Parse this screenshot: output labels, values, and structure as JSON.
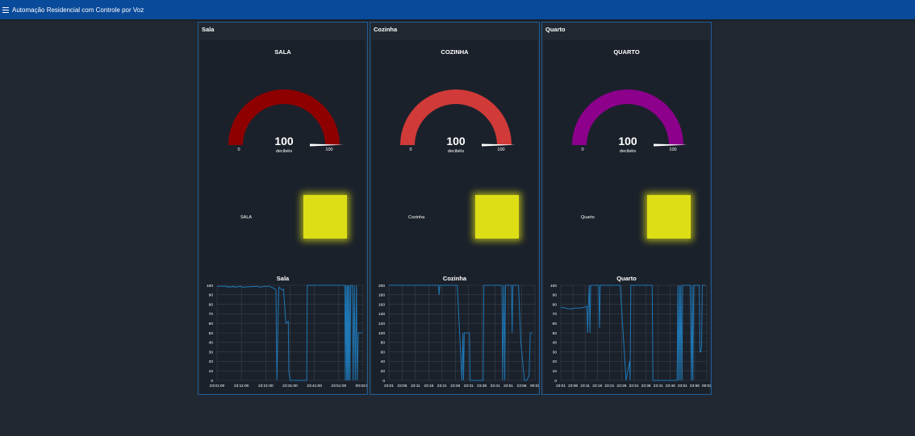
{
  "app": {
    "title": "Automação Residencial com Controle por Voz"
  },
  "groups": [
    {
      "name": "Sala",
      "gauge": {
        "title": "SALA",
        "value": "100",
        "units": "decibéis",
        "min": "0",
        "max": "100",
        "color": "#8e0000"
      },
      "led": {
        "label": "SALA",
        "color": "#dede16"
      }
    },
    {
      "name": "Cozinha",
      "gauge": {
        "title": "COZINHA",
        "value": "100",
        "units": "decibéis",
        "min": "0",
        "max": "100",
        "color": "#d03a38"
      },
      "led": {
        "label": "Cozinha",
        "color": "#dede16"
      }
    },
    {
      "name": "Quarto",
      "gauge": {
        "title": "QUARTO",
        "value": "100",
        "units": "decibéis",
        "min": "0",
        "max": "100",
        "color": "#8c008c"
      },
      "led": {
        "label": "Quarto",
        "color": "#dede16"
      }
    }
  ],
  "chart_data": [
    {
      "type": "line",
      "title": "Sala",
      "ylim": [
        0,
        100
      ],
      "yticks": [
        0,
        10,
        20,
        30,
        40,
        50,
        60,
        70,
        80,
        90,
        100
      ],
      "xticks": [
        "23:01:00",
        "23:11:00",
        "23:21:00",
        "23:31:00",
        "23:41:00",
        "23:51:00",
        "00:02:00"
      ],
      "xrange": [
        0,
        61.5
      ],
      "series_color": "#1f77b4",
      "x": [
        0,
        4,
        4.3,
        5,
        5.2,
        7,
        7.2,
        10,
        10.3,
        17,
        18,
        20,
        22,
        23,
        24.5,
        24.8,
        25.2,
        26,
        27.5,
        28,
        29,
        30,
        30.2,
        30.8,
        31.2,
        31.6,
        32,
        32.5,
        37.8,
        38,
        53.8,
        54,
        54.3,
        54.6,
        54.8,
        55,
        55.2,
        55.5,
        55.8,
        56,
        56.3,
        57,
        57.3,
        57.8,
        58.2,
        58.7,
        59,
        59.5,
        60,
        61.2
      ],
      "y": [
        99,
        99,
        98,
        99,
        98,
        99,
        98,
        99,
        98,
        99,
        98,
        99,
        99,
        98,
        96,
        95,
        0,
        98,
        95,
        96,
        60,
        62,
        10,
        0,
        0,
        0,
        0,
        0,
        0,
        100,
        100,
        0,
        100,
        0,
        100,
        0,
        100,
        0,
        100,
        0,
        100,
        100,
        0,
        100,
        0,
        100,
        0,
        50,
        50,
        50
      ]
    },
    {
      "type": "line",
      "title": "Cozinha",
      "ylim": [
        0,
        200
      ],
      "yticks": [
        0,
        20,
        40,
        60,
        80,
        100,
        120,
        140,
        160,
        180,
        200
      ],
      "xticks": [
        "23:01",
        "23:06",
        "23:11",
        "23:16",
        "23:21",
        "23:26",
        "23:31",
        "23:36",
        "23:41",
        "23:51",
        "23:56",
        "00:02"
      ],
      "xrange": [
        0,
        62
      ],
      "series_color": "#1f77b4",
      "x": [
        0,
        21,
        21.3,
        21.6,
        29,
        31,
        31.4,
        31.7,
        32,
        34.2,
        34.5,
        40,
        40.3,
        48,
        48.3,
        48.8,
        49.2,
        49.5,
        52,
        52.3,
        52.6,
        55,
        56,
        57.5,
        58.5,
        59.5,
        60,
        61
      ],
      "y": [
        200,
        200,
        180,
        200,
        200,
        0,
        100,
        0,
        100,
        100,
        0,
        0,
        200,
        200,
        0,
        200,
        0,
        200,
        200,
        100,
        200,
        200,
        80,
        0,
        0,
        10,
        100,
        100
      ]
    },
    {
      "type": "line",
      "title": "Quarto",
      "ylim": [
        0,
        100
      ],
      "yticks": [
        0,
        10,
        20,
        30,
        40,
        50,
        60,
        70,
        80,
        90,
        100
      ],
      "xticks": [
        "23:01",
        "23:06",
        "23:11",
        "23:16",
        "23:21",
        "23:26",
        "23:31",
        "23:36",
        "23:41",
        "23:46",
        "23:51",
        "23:56",
        "00:02"
      ],
      "xrange": [
        0,
        61.5
      ],
      "series_color": "#1f77b4",
      "x": [
        0,
        2,
        4,
        6,
        8,
        10,
        11,
        11.3,
        11.6,
        12,
        12.3,
        12.6,
        12.9,
        16,
        16.3,
        16.6,
        25,
        27.5,
        29,
        29.2,
        29.5,
        33,
        38.5,
        38.8,
        49,
        49.3,
        49.6,
        50,
        50.3,
        50.6,
        51,
        51.3,
        52,
        54.5,
        55,
        55.3,
        55.6,
        56,
        56.3,
        58.3,
        58.6,
        59,
        59.3,
        59.6,
        60,
        61
      ],
      "y": [
        77,
        76,
        75,
        76,
        76,
        77,
        78,
        50,
        78,
        100,
        50,
        100,
        100,
        100,
        55,
        100,
        100,
        0,
        20,
        0,
        100,
        100,
        100,
        0,
        0,
        100,
        0,
        100,
        0,
        100,
        0,
        100,
        100,
        100,
        0,
        100,
        0,
        100,
        100,
        100,
        30,
        30,
        35,
        100,
        100,
        100
      ]
    }
  ]
}
